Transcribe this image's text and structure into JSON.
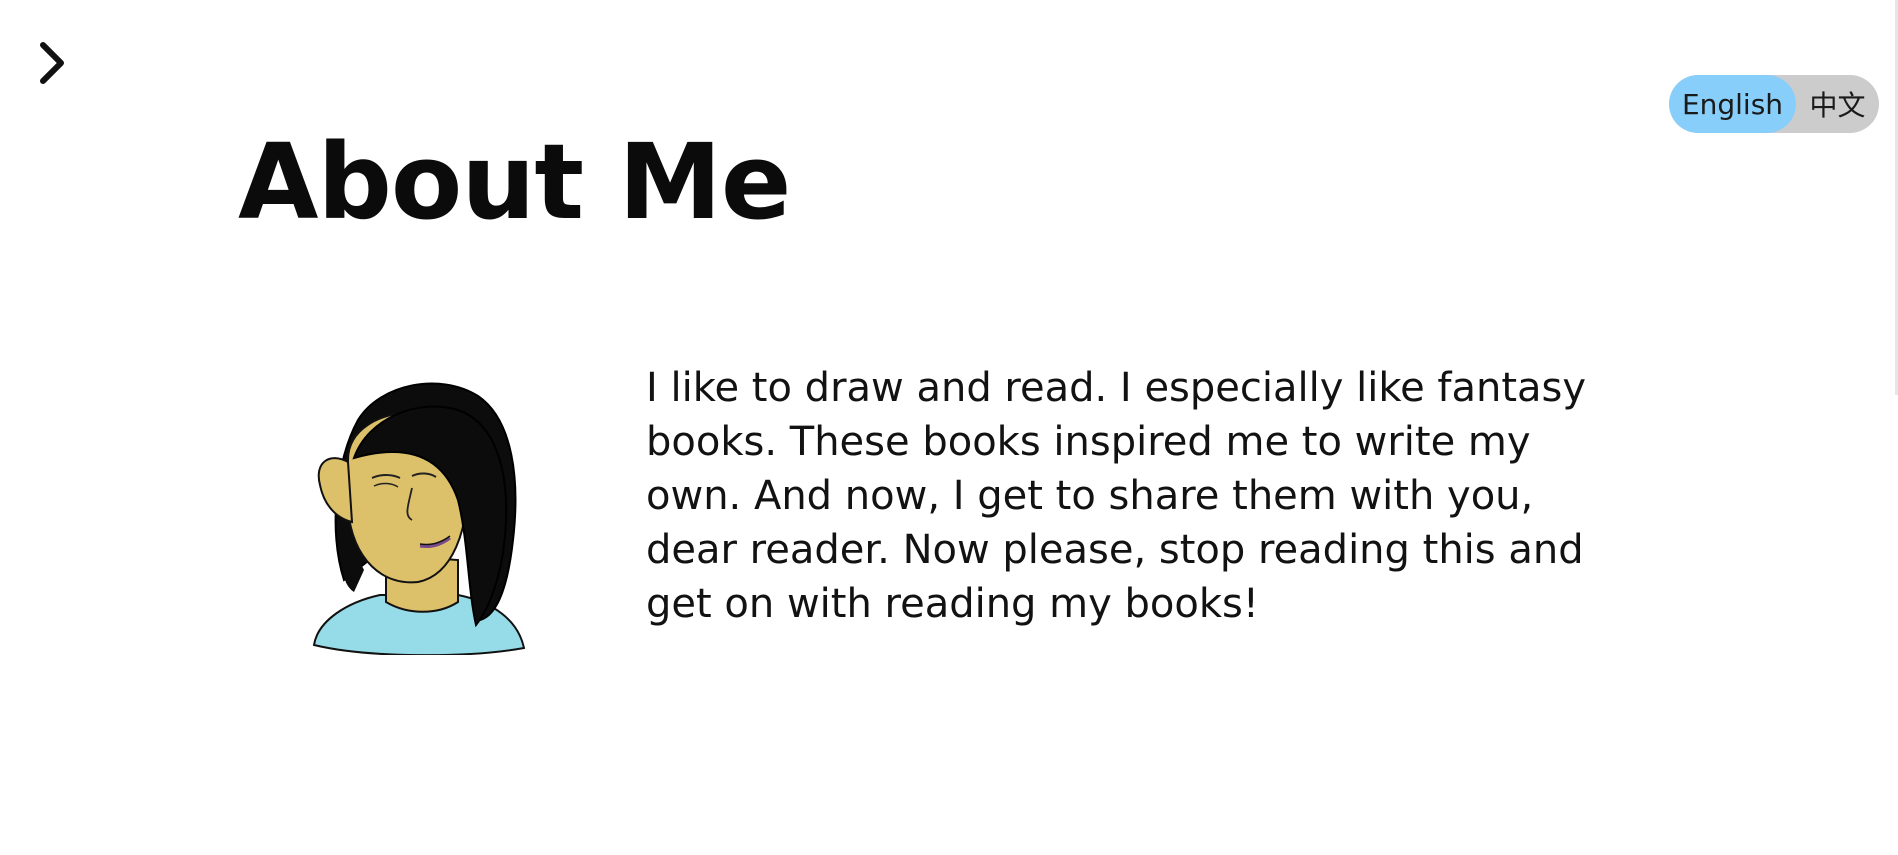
{
  "nav": {
    "toggle_icon": "chevron-right-icon"
  },
  "language": {
    "options": [
      "English",
      "中文"
    ],
    "active": "English",
    "active_color": "#87cefa",
    "inactive_color": "#cccccc"
  },
  "main": {
    "title": "About Me",
    "bio": "I like to draw and read. I especially like fantasy books. These books inspired me to write my own. And now, I get to share them with you, dear reader. Now please, stop reading this and get on with reading my books!",
    "portrait_icon": "author-portrait-drawing"
  }
}
